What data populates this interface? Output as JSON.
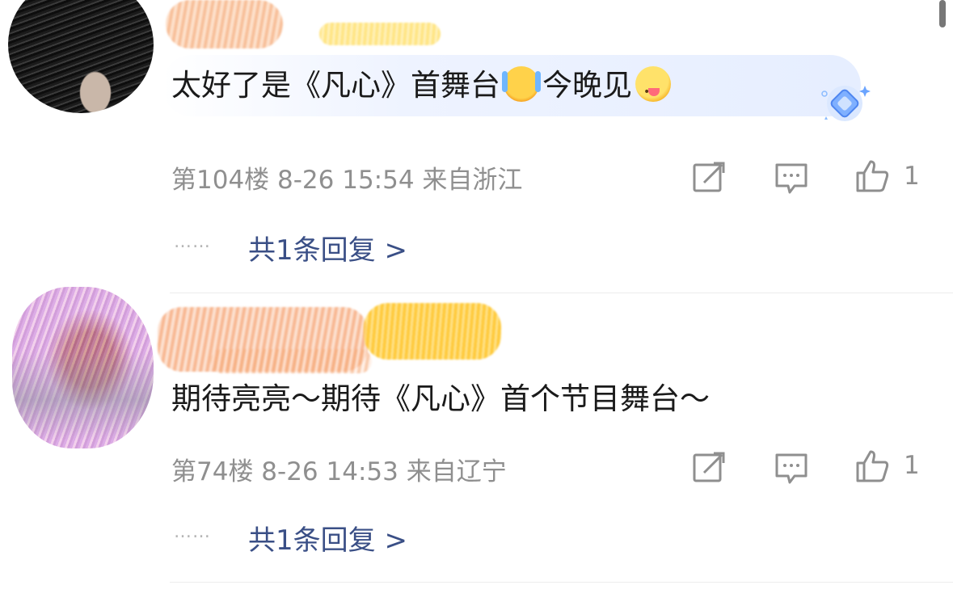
{
  "comments": [
    {
      "text_before_emoji": "太好了是《凡心》首舞台",
      "text_middle": "今晚见",
      "emoji_1": "laughing-tears-emoji",
      "emoji_2": "yum-face-emoji",
      "meta": "第104楼 8-26 15:54 来自浙江",
      "like_count": "1",
      "replies_link": "共1条回复 >",
      "reply_dots": "……"
    },
    {
      "text": "期待亮亮～期待《凡心》首个节目舞台～",
      "meta": "第74楼 8-26 14:53 来自辽宁",
      "like_count": "1",
      "replies_link": "共1条回复 >",
      "reply_dots": "……"
    }
  ],
  "icons": {
    "share": "share-edit-icon",
    "comment": "comment-bubble-icon",
    "like": "thumbs-up-icon",
    "badge": "diamond-badge-icon"
  },
  "colors": {
    "link": "#3a4f86",
    "meta": "#8f8f8f",
    "text": "#1a1a1a",
    "bubble": "#e6eeff"
  }
}
